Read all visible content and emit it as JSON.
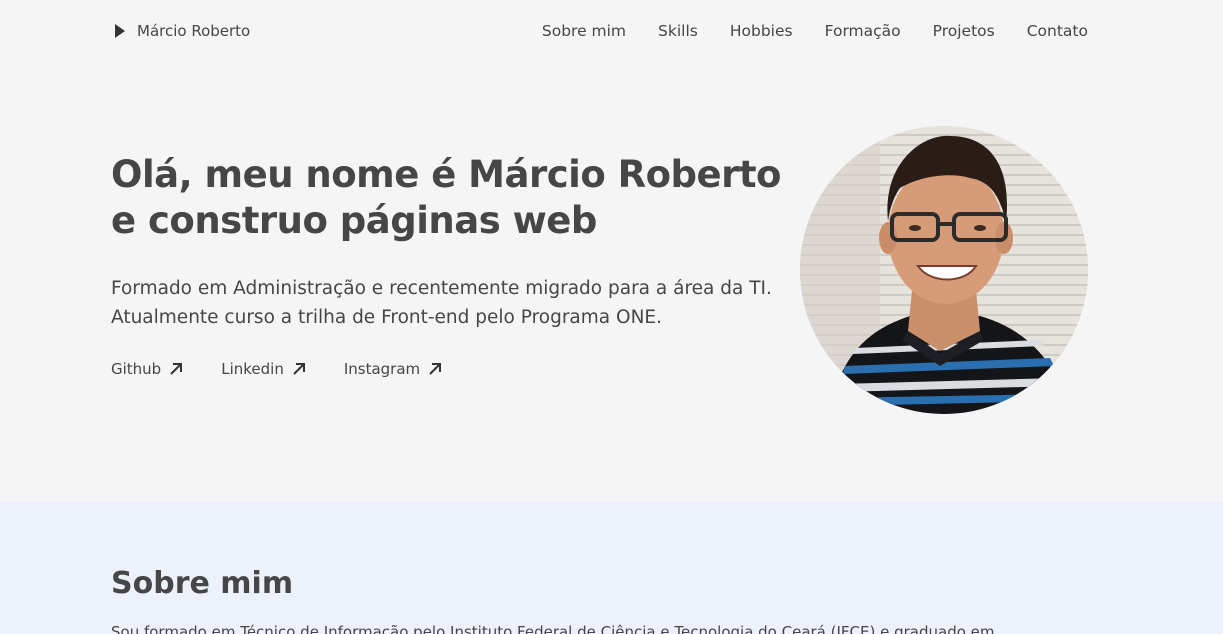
{
  "header": {
    "brand": "Márcio Roberto",
    "nav": [
      "Sobre mim",
      "Skills",
      "Hobbies",
      "Formação",
      "Projetos",
      "Contato"
    ]
  },
  "hero": {
    "title_line1": "Olá, meu nome é Márcio Roberto",
    "title_line2": "e construo páginas web",
    "description": "Formado em Administração e recentemente migrado para a área da TI. Atualmente curso a trilha de Front-end pelo Programa ONE.",
    "links": [
      "Github",
      "Linkedin",
      "Instagram"
    ]
  },
  "about": {
    "title": "Sobre mim",
    "text": "Sou formado em Técnico de Informação pelo Instituto Federal de Ciência e Tecnologia do Ceará (IFCE) e graduado em"
  },
  "colors": {
    "background": "#f5f5f5",
    "text": "#464646",
    "about_background": "#ecf1fc"
  },
  "icons": {
    "brand": "play-icon",
    "external_link": "arrow-up-right-icon"
  }
}
